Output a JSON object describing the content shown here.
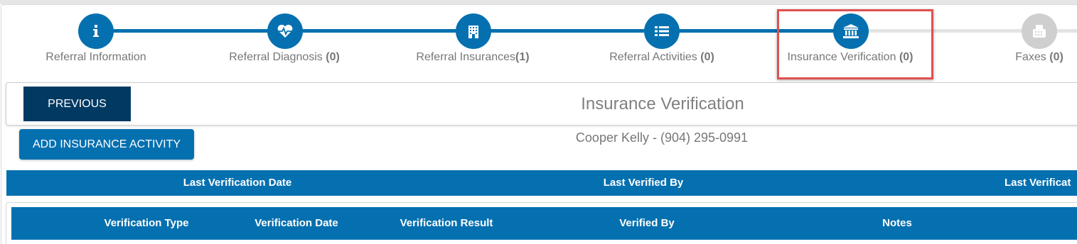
{
  "wizard": {
    "steps": [
      {
        "label": "Referral Information",
        "count": "",
        "icon": "info-icon",
        "state": "done"
      },
      {
        "label": "Referral Diagnosis",
        "count": "(0)",
        "icon": "heartbeat-icon",
        "state": "done"
      },
      {
        "label": "Referral Insurances",
        "count": "(1)",
        "icon": "hospital-icon",
        "state": "done"
      },
      {
        "label": "Referral Activities",
        "count": "(0)",
        "icon": "list-icon",
        "state": "done"
      },
      {
        "label": "Insurance Verification",
        "count": "(0)",
        "icon": "bank-icon",
        "state": "active"
      },
      {
        "label": "Faxes",
        "count": "(0)",
        "icon": "fax-icon",
        "state": "inactive"
      }
    ]
  },
  "header": {
    "previous_label": "PREVIOUS",
    "title": "Insurance Verification"
  },
  "actions": {
    "add_insurance_activity_label": "ADD INSURANCE ACTIVITY"
  },
  "patient": {
    "line": "Cooper Kelly - (904) 295-0991"
  },
  "summary_table": {
    "columns": [
      "Last Verification Date",
      "Last Verified By",
      "Last Verificat"
    ]
  },
  "detail_table": {
    "columns": [
      "Verification Type",
      "Verification Date",
      "Verification Result",
      "Verified By",
      "Notes"
    ]
  },
  "colors": {
    "primary": "#0570b0",
    "dark_button": "#003a63",
    "inactive_step": "#cfcfcf",
    "highlight": "#e05050"
  }
}
